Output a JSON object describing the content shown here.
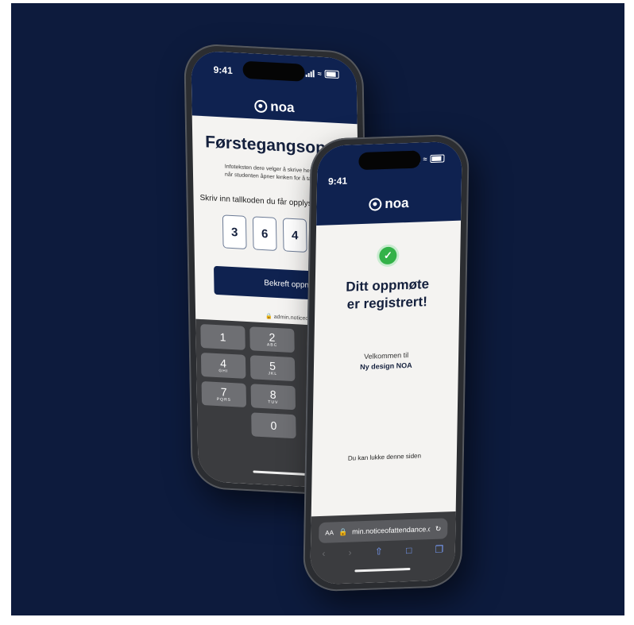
{
  "back_phone": {
    "status": {
      "time": "9:41"
    },
    "logo_text": "noa",
    "title": "Førstegangsoppmøte",
    "info_text": [
      "Infoteksten dere velger å skrive her,",
      "når studenten åpner lenken for å ta"
    ],
    "prompt": "Skriv inn tallkoden du får opplyst",
    "digits": [
      "3",
      "6",
      "4"
    ],
    "confirm_button": "Bekreft oppmøte",
    "url": "admin.noticeofattendance.com",
    "keypad": [
      [
        {
          "d": "1",
          "l": ""
        },
        {
          "d": "2",
          "l": "ABC"
        }
      ],
      [
        {
          "d": "4",
          "l": "GHI"
        },
        {
          "d": "5",
          "l": "JKL"
        }
      ],
      [
        {
          "d": "7",
          "l": "PQRS"
        },
        {
          "d": "8",
          "l": "TUV"
        }
      ],
      [
        {
          "d": "",
          "l": ""
        },
        {
          "d": "0",
          "l": ""
        }
      ]
    ]
  },
  "front_phone": {
    "status": {
      "time": "9:41"
    },
    "logo_text": "noa",
    "success_title_line1": "Ditt oppmøte",
    "success_title_line2": "er registrert!",
    "welcome": "Velkommen til",
    "design_name": "Ny design NOA",
    "close_message": "Du kan lukke denne siden",
    "browser": {
      "aa": "AA",
      "url": "min.noticeofattendance.com"
    }
  },
  "colors": {
    "background": "#0d1b3d",
    "header": "#0f2250",
    "success": "#33b248"
  }
}
